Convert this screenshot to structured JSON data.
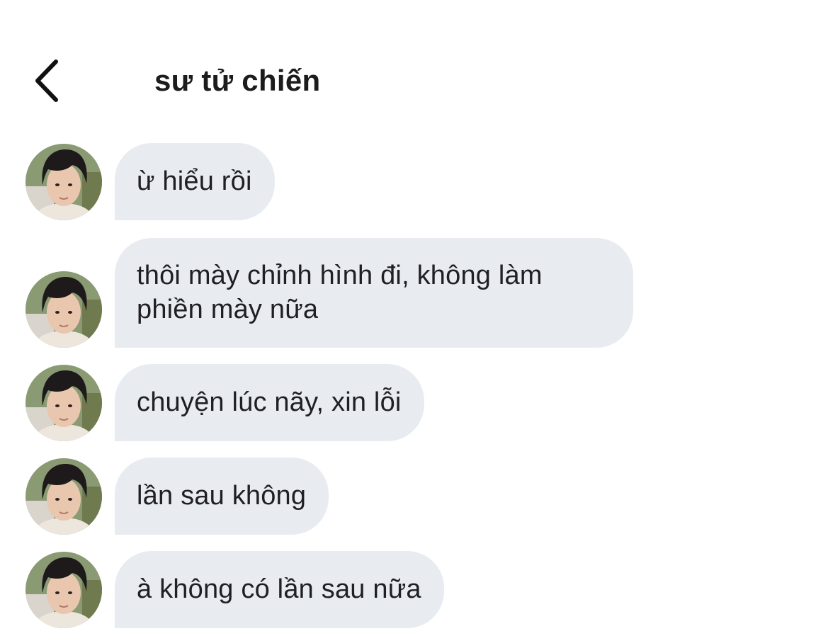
{
  "header": {
    "title": "sư tử chiến",
    "back_icon": "chevron-left-icon"
  },
  "messages": [
    {
      "text": "ừ hiểu rồi"
    },
    {
      "text": "thôi mày chỉnh hình đi, không làm phiền mày nữa"
    },
    {
      "text": "chuyện lúc nãy, xin lỗi"
    },
    {
      "text": "lần sau không"
    },
    {
      "text": "à không có lần sau nữa"
    }
  ],
  "colors": {
    "bubble_background": "#e8ecf0",
    "text": "#1c1c1e",
    "background": "#ffffff"
  }
}
